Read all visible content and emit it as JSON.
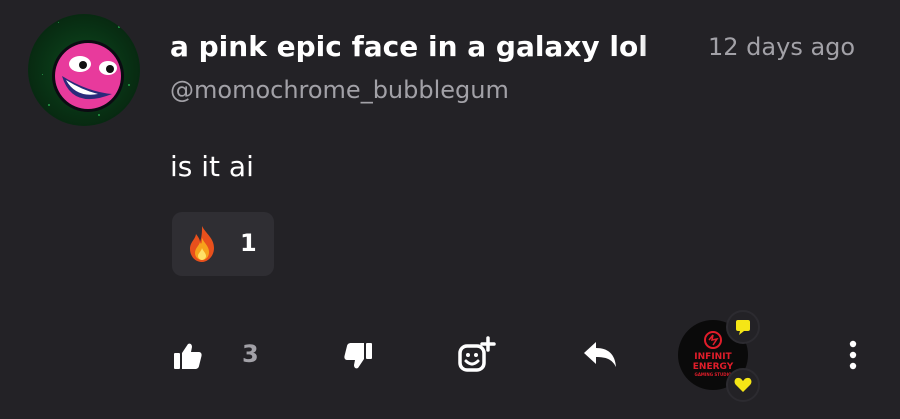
{
  "post": {
    "title": "a pink epic face in a galaxy lol",
    "timestamp": "12 days ago",
    "handle": "@momochrome_bubblegum",
    "message": "is it ai"
  },
  "reaction": {
    "emoji": "fire-icon",
    "count": "1"
  },
  "actions": {
    "like_count": "3",
    "icons": [
      "thumbs-up-icon",
      "thumbs-down-icon",
      "add-reaction-icon",
      "reply-icon",
      "more-options-icon"
    ]
  },
  "reply_avatar": {
    "line1": "INFINIT",
    "line2": "ENERGY",
    "line3": "GAMING STUDIO",
    "brand_color": "#e11d2a",
    "badge_color": "#f5e616"
  },
  "colors": {
    "background": "#232226",
    "muted_text": "#a2a1a7",
    "chip_background": "#2f2e33"
  }
}
